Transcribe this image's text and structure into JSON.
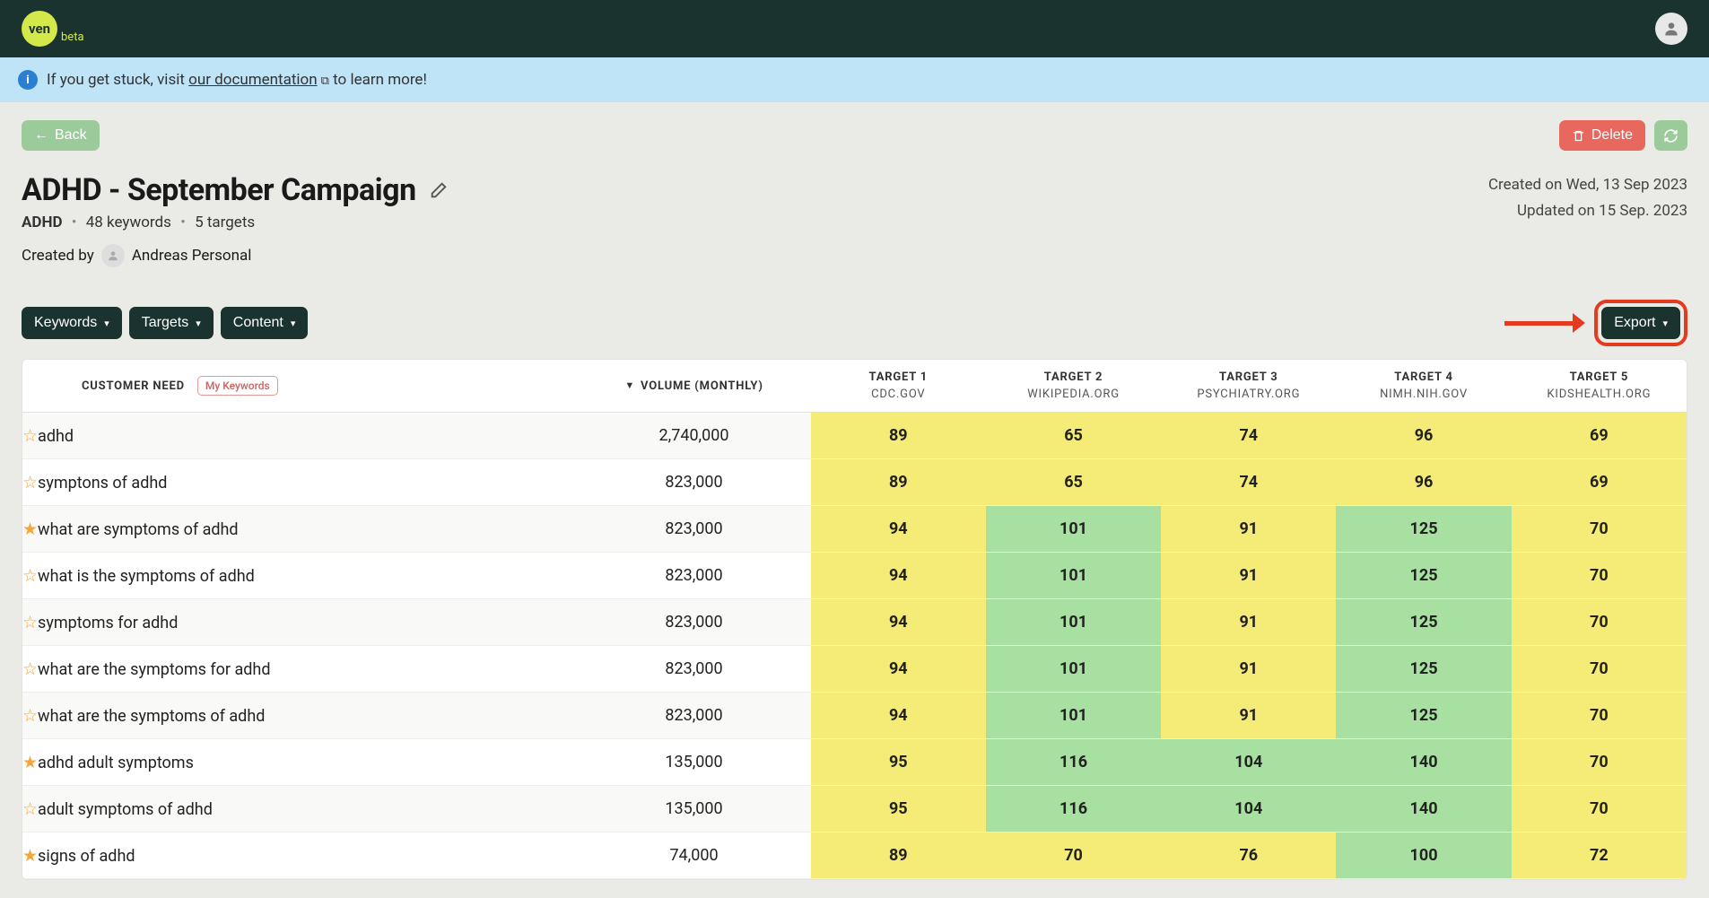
{
  "brand": {
    "logo_text": "ven",
    "beta": "beta"
  },
  "banner": {
    "prefix": "If you get stuck, visit ",
    "link": "our documentation",
    "suffix": " to learn more!"
  },
  "actions": {
    "back": "Back",
    "delete": "Delete",
    "export": "Export"
  },
  "header": {
    "title": "ADHD - September Campaign",
    "created_on": "Created on Wed, 13 Sep 2023",
    "updated_on": "Updated on 15 Sep. 2023",
    "topic": "ADHD",
    "keyword_count": "48 keywords",
    "target_count": "5 targets",
    "created_by_label": "Created by",
    "created_by_name": "Andreas Personal"
  },
  "filters": {
    "keywords": "Keywords",
    "targets": "Targets",
    "content": "Content"
  },
  "table": {
    "headers": {
      "need": "CUSTOMER NEED",
      "badge": "My Keywords",
      "volume": "VOLUME (MONTHLY)",
      "targets": [
        {
          "label": "TARGET 1",
          "domain": "CDC.GOV"
        },
        {
          "label": "TARGET 2",
          "domain": "WIKIPEDIA.ORG"
        },
        {
          "label": "TARGET 3",
          "domain": "PSYCHIATRY.ORG"
        },
        {
          "label": "TARGET 4",
          "domain": "NIMH.NIH.GOV"
        },
        {
          "label": "TARGET 5",
          "domain": "KIDSHEALTH.ORG"
        }
      ]
    },
    "rows": [
      {
        "star": false,
        "need": "adhd",
        "volume": "2,740,000",
        "scores": [
          {
            "v": "89",
            "c": "c-yellow"
          },
          {
            "v": "65",
            "c": "c-yellow"
          },
          {
            "v": "74",
            "c": "c-yellow"
          },
          {
            "v": "96",
            "c": "c-yellow"
          },
          {
            "v": "69",
            "c": "c-yellow"
          }
        ]
      },
      {
        "star": false,
        "need": "symptons of adhd",
        "volume": "823,000",
        "scores": [
          {
            "v": "89",
            "c": "c-yellow"
          },
          {
            "v": "65",
            "c": "c-yellow"
          },
          {
            "v": "74",
            "c": "c-yellow"
          },
          {
            "v": "96",
            "c": "c-yellow"
          },
          {
            "v": "69",
            "c": "c-yellow"
          }
        ]
      },
      {
        "star": true,
        "need": "what are symptoms of adhd",
        "volume": "823,000",
        "scores": [
          {
            "v": "94",
            "c": "c-yellow"
          },
          {
            "v": "101",
            "c": "c-green"
          },
          {
            "v": "91",
            "c": "c-yellow"
          },
          {
            "v": "125",
            "c": "c-green"
          },
          {
            "v": "70",
            "c": "c-yellow"
          }
        ]
      },
      {
        "star": false,
        "need": "what is the symptoms of adhd",
        "volume": "823,000",
        "scores": [
          {
            "v": "94",
            "c": "c-yellow"
          },
          {
            "v": "101",
            "c": "c-green"
          },
          {
            "v": "91",
            "c": "c-yellow"
          },
          {
            "v": "125",
            "c": "c-green"
          },
          {
            "v": "70",
            "c": "c-yellow"
          }
        ]
      },
      {
        "star": false,
        "need": "symptoms for adhd",
        "volume": "823,000",
        "scores": [
          {
            "v": "94",
            "c": "c-yellow"
          },
          {
            "v": "101",
            "c": "c-green"
          },
          {
            "v": "91",
            "c": "c-yellow"
          },
          {
            "v": "125",
            "c": "c-green"
          },
          {
            "v": "70",
            "c": "c-yellow"
          }
        ]
      },
      {
        "star": false,
        "need": "what are the symptoms for adhd",
        "volume": "823,000",
        "scores": [
          {
            "v": "94",
            "c": "c-yellow"
          },
          {
            "v": "101",
            "c": "c-green"
          },
          {
            "v": "91",
            "c": "c-yellow"
          },
          {
            "v": "125",
            "c": "c-green"
          },
          {
            "v": "70",
            "c": "c-yellow"
          }
        ]
      },
      {
        "star": false,
        "need": "what are the symptoms of adhd",
        "volume": "823,000",
        "scores": [
          {
            "v": "94",
            "c": "c-yellow"
          },
          {
            "v": "101",
            "c": "c-green"
          },
          {
            "v": "91",
            "c": "c-yellow"
          },
          {
            "v": "125",
            "c": "c-green"
          },
          {
            "v": "70",
            "c": "c-yellow"
          }
        ]
      },
      {
        "star": true,
        "need": "adhd adult symptoms",
        "volume": "135,000",
        "scores": [
          {
            "v": "95",
            "c": "c-yellow"
          },
          {
            "v": "116",
            "c": "c-green"
          },
          {
            "v": "104",
            "c": "c-green"
          },
          {
            "v": "140",
            "c": "c-green"
          },
          {
            "v": "70",
            "c": "c-yellow"
          }
        ]
      },
      {
        "star": false,
        "need": "adult symptoms of adhd",
        "volume": "135,000",
        "scores": [
          {
            "v": "95",
            "c": "c-yellow"
          },
          {
            "v": "116",
            "c": "c-green"
          },
          {
            "v": "104",
            "c": "c-green"
          },
          {
            "v": "140",
            "c": "c-green"
          },
          {
            "v": "70",
            "c": "c-yellow"
          }
        ]
      },
      {
        "star": true,
        "need": "signs of adhd",
        "volume": "74,000",
        "scores": [
          {
            "v": "89",
            "c": "c-yellow"
          },
          {
            "v": "70",
            "c": "c-yellow"
          },
          {
            "v": "76",
            "c": "c-yellow"
          },
          {
            "v": "100",
            "c": "c-green"
          },
          {
            "v": "72",
            "c": "c-yellow"
          }
        ]
      }
    ]
  }
}
